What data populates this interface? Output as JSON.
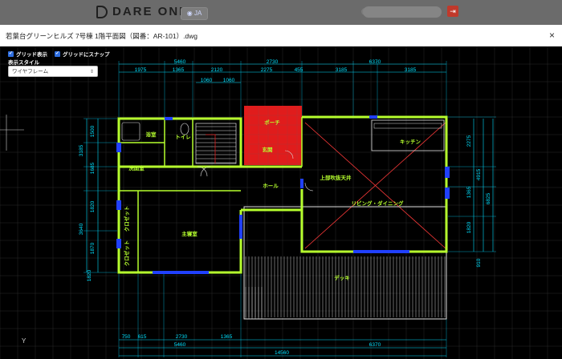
{
  "header": {
    "logo_text": "DARE ONE",
    "lang_label": "JA",
    "exit_icon": "exit-icon"
  },
  "doc": {
    "title": "若葉台グリーンヒルズ 7号棟 1階平面図（図番：AR-101）.dwg",
    "close_label": "×"
  },
  "controls": {
    "grid_display": "グリッド表示",
    "grid_snap": "グリッドにスナップ",
    "style_label": "表示スタイル",
    "style_value": "ワイヤフレーム"
  },
  "plan": {
    "dims_top_row1": [
      "5460",
      "2730",
      "6370"
    ],
    "dims_top_row2": [
      "1975",
      "1365",
      "2120",
      "2275",
      "455",
      "3185",
      "3185"
    ],
    "dims_top_row3": [
      "1060",
      "1060"
    ],
    "dims_left": [
      "1500",
      "3185",
      "1685",
      "1820",
      "3640",
      "1870",
      "1820"
    ],
    "dims_right": [
      "2275",
      "4915",
      "1365",
      "1820",
      "6825",
      "910"
    ],
    "dims_bottom_row1": [
      "750",
      "615",
      "2730",
      "1365"
    ],
    "dims_bottom_row2": [
      "5460",
      "6370"
    ],
    "dims_bottom_total": "14560",
    "rooms": {
      "bath": "浴室",
      "toilet": "トイレ",
      "porch": "ポーチ",
      "entrance": "玄関",
      "kitchen": "キッチン",
      "washroom": "洗面室",
      "hall": "ホール",
      "atrium": "上部吹抜天井",
      "living": "リビング・ダイニング",
      "closet1": "クロゼット",
      "closet2": "クロゼット",
      "bedroom": "主寝室",
      "deck": "デッキ"
    },
    "axis_y": "Y",
    "colors": {
      "wall": "#b6ff2e",
      "dim": "#00e0ff",
      "grid": "#2a2a2a",
      "porch": "#e01c1c",
      "room_text": "#b6ff2e",
      "dim_text": "#00e0ff",
      "atrium_cross": "#ff3a3a"
    }
  }
}
